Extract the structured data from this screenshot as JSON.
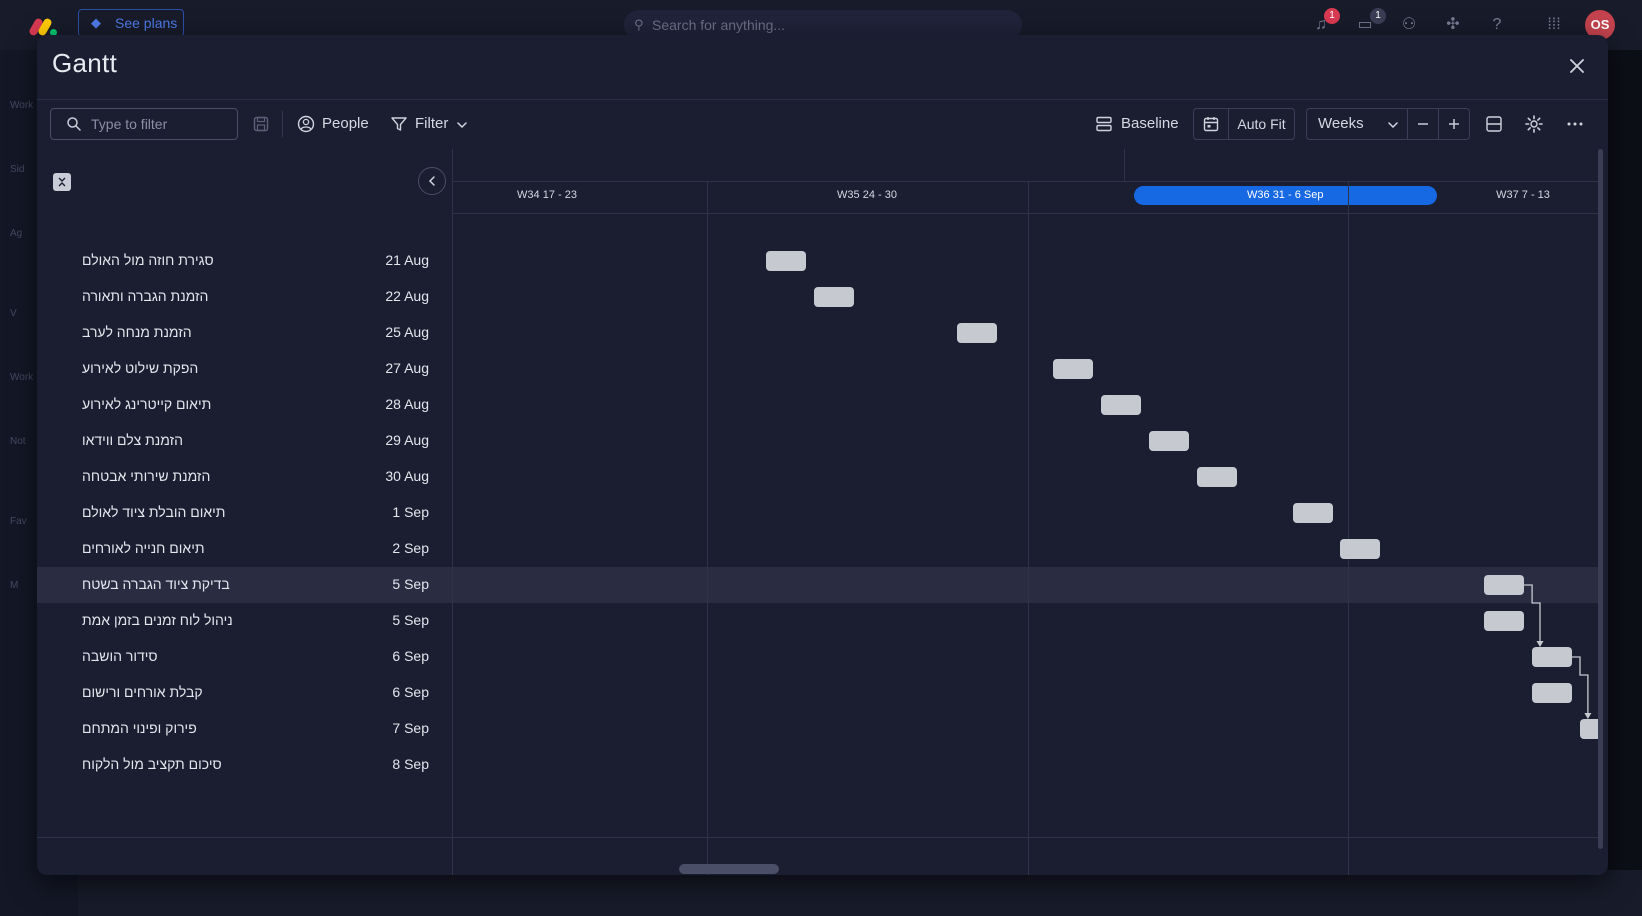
{
  "background": {
    "see_plans": "See plans",
    "search_placeholder": "Search for anything...",
    "notifications_count": "1",
    "inbox_count": "1",
    "avatar_initials": "OS",
    "sidebar_labels": [
      "Work",
      "Sid",
      "Ag",
      "V",
      "Work",
      "Not",
      "Fav",
      "M"
    ]
  },
  "modal": {
    "title": "Gantt",
    "close_icon": "close-icon"
  },
  "toolbar": {
    "filter_placeholder": "Type to filter",
    "people_label": "People",
    "filter_label": "Filter",
    "baseline_label": "Baseline",
    "autofit_label": "Auto Fit",
    "scale_value": "Weeks"
  },
  "timeline": {
    "weeks": [
      {
        "label": "W34 17 - 23",
        "current": false
      },
      {
        "label": "W35 24 - 30",
        "current": false
      },
      {
        "label": "W36 31 - 6 Sep",
        "current": true
      },
      {
        "label": "W37 7 - 13",
        "current": false
      }
    ]
  },
  "tasks": [
    {
      "name": "סגירת חוזה מול האולם",
      "date": "21 Aug"
    },
    {
      "name": "הזמנת הגברה ותאורה",
      "date": "22 Aug"
    },
    {
      "name": "הזמנת מנחה לערב",
      "date": "25 Aug"
    },
    {
      "name": "הפקת שילוט לאירוע",
      "date": "27 Aug"
    },
    {
      "name": "תיאום קייטרינג לאירוע",
      "date": "28 Aug"
    },
    {
      "name": "הזמנת צלם ווידאו",
      "date": "29 Aug"
    },
    {
      "name": "הזמנת שירותי אבטחה",
      "date": "30 Aug"
    },
    {
      "name": "תיאום הובלת ציוד לאולם",
      "date": "1 Sep"
    },
    {
      "name": "תיאום חנייה לאורחים",
      "date": "2 Sep"
    },
    {
      "name": "בדיקת ציוד הגברה בשטח",
      "date": "5 Sep"
    },
    {
      "name": "ניהול לוח זמנים בזמן אמת",
      "date": "5 Sep"
    },
    {
      "name": "סידור הושבה",
      "date": "6 Sep"
    },
    {
      "name": "קבלת אורחים ורישום",
      "date": "6 Sep"
    },
    {
      "name": "פירוק ופינוי המתחם",
      "date": "7 Sep"
    },
    {
      "name": "סיכום תקציב מול הלקוח",
      "date": "8 Sep"
    }
  ],
  "hovered_task": 9,
  "dependencies": [
    [
      9,
      11
    ],
    [
      11,
      13
    ]
  ],
  "colors": {
    "accent": "#1668e3",
    "bar": "#c7c9d1",
    "modal_bg": "#1b1e30"
  }
}
